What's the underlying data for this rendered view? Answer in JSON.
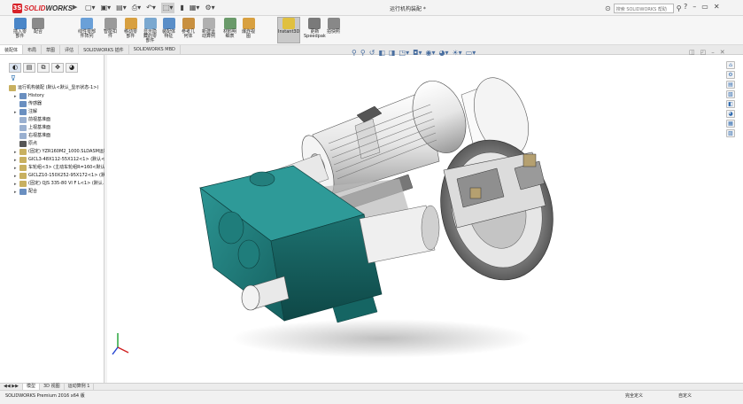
{
  "titlebar": {
    "brand_ds": "3S",
    "brand_a": "SOLID",
    "brand_b": "WORKS",
    "doc_title": "运行机构装配 *",
    "search_prefix": "搜索",
    "search_placeholder": "SOLIDWORKS 帮助",
    "help_label": "?"
  },
  "commands": [
    {
      "label": "插入零\n部件",
      "icon_color": "#4a86c8"
    },
    {
      "label": "配合",
      "icon_color": "#8a8a8a"
    },
    {
      "label": "线性零部\n件阵列",
      "icon_color": "#6aa0d8"
    },
    {
      "label": "智能扣\n件",
      "icon_color": "#9a9a9a"
    },
    {
      "label": "移动零\n部件",
      "icon_color": "#d8a040"
    },
    {
      "label": "显示隐\n藏的零\n部件",
      "icon_color": "#7aa8d0"
    },
    {
      "label": "装配体\n特征",
      "icon_color": "#5a8ec8"
    },
    {
      "label": "参考几\n何体",
      "icon_color": "#c89040"
    },
    {
      "label": "新建运\n动算例",
      "icon_color": "#b0b0b0"
    },
    {
      "label": "材料明\n细表",
      "icon_color": "#6a9a6a"
    },
    {
      "label": "爆炸视\n图",
      "icon_color": "#d8a040"
    },
    {
      "label": "Instant3D",
      "icon_color": "#e0c040"
    },
    {
      "label": "更新\nSpeedpak",
      "icon_color": "#7a7a7a"
    },
    {
      "label": "拍快照",
      "icon_color": "#888888"
    }
  ],
  "cm_tabs": [
    "装配体",
    "布局",
    "草图",
    "评估",
    "SOLIDWORKS 插件",
    "SOLIDWORKS MBD"
  ],
  "tree": {
    "root": "运行机构装配 (默认<默认_显示状态-1>)",
    "items": [
      {
        "label": "History",
        "icon": "history-icon",
        "color": "#6a8fc0",
        "expand": "▸"
      },
      {
        "label": "传感器",
        "icon": "sensor-icon",
        "color": "#6a8fc0",
        "expand": ""
      },
      {
        "label": "注解",
        "icon": "annotation-icon",
        "color": "#6a8fc0",
        "expand": "▸"
      },
      {
        "label": "前视基准面",
        "icon": "plane-icon",
        "color": "#9ab0d0",
        "expand": ""
      },
      {
        "label": "上视基准面",
        "icon": "plane-icon",
        "color": "#9ab0d0",
        "expand": ""
      },
      {
        "label": "右视基准面",
        "icon": "plane-icon",
        "color": "#9ab0d0",
        "expand": ""
      },
      {
        "label": "原点",
        "icon": "origin-icon",
        "color": "#555555",
        "expand": ""
      },
      {
        "label": "(固定) YZR160M2_1000.SLDASM运行…",
        "icon": "part-icon",
        "color": "#c8b060",
        "expand": "▸"
      },
      {
        "label": "GICL3-48X112-55X112<1> (默认<…",
        "icon": "part-icon",
        "color": "#c8b060",
        "expand": "▸"
      },
      {
        "label": "车轮组<3> (主动车轮组R=160<默认…",
        "icon": "part-icon",
        "color": "#c8b060",
        "expand": "▸"
      },
      {
        "label": "GICLZ10-150X252-95X172<1> (默…",
        "icon": "part-icon",
        "color": "#c8b060",
        "expand": "▸"
      },
      {
        "label": "(固定) QJS 335-80 VI F L<1> (默认…",
        "icon": "part-icon",
        "color": "#c8b060",
        "expand": "▸"
      },
      {
        "label": "配合",
        "icon": "mates-icon",
        "color": "#6a8fc0",
        "expand": "▸"
      }
    ]
  },
  "bottom_tabs": [
    "模型",
    "3D 视图",
    "运动算例 1"
  ],
  "status": {
    "product": "SOLIDWORKS Premium 2016 x64 版",
    "state": "完全定义",
    "units": "自定义"
  },
  "colors": {
    "gearbox": "#1f7f7d",
    "motor": "#f2f2f2",
    "brand_red": "#d8232a"
  }
}
